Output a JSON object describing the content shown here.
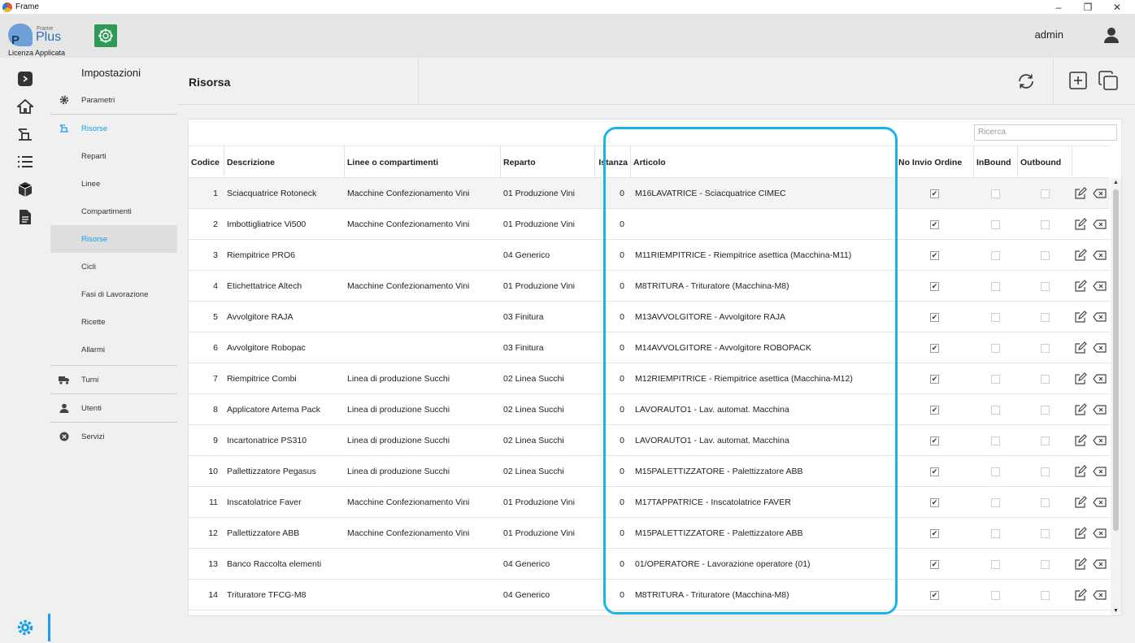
{
  "window": {
    "title": "Frame",
    "minimize": "–",
    "restore": "❐",
    "close": "✕"
  },
  "header": {
    "logo_letter": "P",
    "logo_frame": "Frame",
    "logo_plus": "Plus",
    "license": "Licenza Applicata",
    "user": "admin"
  },
  "settings": {
    "title": "Impostazioni",
    "items": [
      {
        "label": "Parametri",
        "icon": "gear-icon"
      },
      {
        "label": "Risorse",
        "icon": "resource-icon"
      },
      {
        "label": "Reparti"
      },
      {
        "label": "Linee"
      },
      {
        "label": "Compartimenti"
      },
      {
        "label": "Risorse"
      },
      {
        "label": "Cicli"
      },
      {
        "label": "Fasi di Lavorazione"
      },
      {
        "label": "Ricette"
      },
      {
        "label": "Allarmi"
      },
      {
        "label": "Turni",
        "icon": "truck-icon"
      },
      {
        "label": "Utenti",
        "icon": "user-icon"
      },
      {
        "label": "Servizi",
        "icon": "services-icon"
      }
    ]
  },
  "main": {
    "title": "Risorsa",
    "search_placeholder": "Ricerca"
  },
  "table": {
    "columns": [
      "Codice",
      "Descrizione",
      "Linee o compartimenti",
      "Reparto",
      "Istanza",
      "Articolo",
      "No Invio Ordine",
      "InBound",
      "Outbound"
    ],
    "rows": [
      {
        "codice": "1",
        "descrizione": "Sciacquatrice Rotoneck",
        "linee": "Macchine Confezionamento Vini",
        "reparto": "01 Produzione Vini",
        "istanza": "0",
        "articolo": "M16LAVATRICE - Sciacquatrice CIMEC",
        "no_invio": true,
        "inbound": false,
        "outbound": false
      },
      {
        "codice": "2",
        "descrizione": "Imbottigliatrice Vi500",
        "linee": "Macchine Confezionamento Vini",
        "reparto": "01 Produzione Vini",
        "istanza": "0",
        "articolo": "",
        "no_invio": true,
        "inbound": false,
        "outbound": false
      },
      {
        "codice": "3",
        "descrizione": "Riempitrice PRO6",
        "linee": "",
        "reparto": "04 Generico",
        "istanza": "0",
        "articolo": "M11RIEMPITRICE - Riempitrice asettica (Macchina-M11)",
        "no_invio": true,
        "inbound": false,
        "outbound": false
      },
      {
        "codice": "4",
        "descrizione": "Etichettatrice Altech",
        "linee": "Macchine Confezionamento Vini",
        "reparto": "01 Produzione Vini",
        "istanza": "0",
        "articolo": "M8TRITURA - Trituratore (Macchina-M8)",
        "no_invio": true,
        "inbound": false,
        "outbound": false
      },
      {
        "codice": "5",
        "descrizione": "Avvolgitore RAJA",
        "linee": "",
        "reparto": "03 Finitura",
        "istanza": "0",
        "articolo": "M13AVVOLGITORE - Avvolgitore RAJA",
        "no_invio": true,
        "inbound": false,
        "outbound": false
      },
      {
        "codice": "6",
        "descrizione": "Avvolgitore Robopac",
        "linee": "",
        "reparto": "03 Finitura",
        "istanza": "0",
        "articolo": "M14AVVOLGITORE - Avvolgitore ROBOPACK",
        "no_invio": true,
        "inbound": false,
        "outbound": false
      },
      {
        "codice": "7",
        "descrizione": "Riempitrice Combi",
        "linee": "Linea di produzione Succhi",
        "reparto": "02 Linea Succhi",
        "istanza": "0",
        "articolo": "M12RIEMPITRICE - Riempitrice asettica (Macchina-M12)",
        "no_invio": true,
        "inbound": false,
        "outbound": false
      },
      {
        "codice": "8",
        "descrizione": "Applicatore Artema Pack",
        "linee": "Linea di produzione Succhi",
        "reparto": "02 Linea Succhi",
        "istanza": "0",
        "articolo": "LAVORAUTO1 - Lav. automat. Macchina",
        "no_invio": true,
        "inbound": false,
        "outbound": false
      },
      {
        "codice": "9",
        "descrizione": "Incartonatrice PS310",
        "linee": "Linea di produzione Succhi",
        "reparto": "02 Linea Succhi",
        "istanza": "0",
        "articolo": "LAVORAUTO1 - Lav. automat. Macchina",
        "no_invio": true,
        "inbound": false,
        "outbound": false
      },
      {
        "codice": "10",
        "descrizione": "Pallettizzatore Pegasus",
        "linee": "Linea di produzione Succhi",
        "reparto": "02 Linea Succhi",
        "istanza": "0",
        "articolo": "M15PALETTIZZATORE - Palettizzatore ABB",
        "no_invio": true,
        "inbound": false,
        "outbound": false
      },
      {
        "codice": "11",
        "descrizione": "Inscatolatrice Faver",
        "linee": "Macchine Confezionamento Vini",
        "reparto": "01 Produzione Vini",
        "istanza": "0",
        "articolo": "M17TAPPATRICE - Inscatolatrice FAVER",
        "no_invio": true,
        "inbound": false,
        "outbound": false
      },
      {
        "codice": "12",
        "descrizione": "Pallettizzatore ABB",
        "linee": "Macchine Confezionamento Vini",
        "reparto": "01 Produzione Vini",
        "istanza": "0",
        "articolo": "M15PALETTIZZATORE - Palettizzatore ABB",
        "no_invio": true,
        "inbound": false,
        "outbound": false
      },
      {
        "codice": "13",
        "descrizione": "Banco Raccolta elementi",
        "linee": "",
        "reparto": "04 Generico",
        "istanza": "0",
        "articolo": "01/OPERATORE - Lavorazione operatore (01)",
        "no_invio": true,
        "inbound": false,
        "outbound": false
      },
      {
        "codice": "14",
        "descrizione": "Trituratore TFCG-M8",
        "linee": "",
        "reparto": "04 Generico",
        "istanza": "0",
        "articolo": "M8TRITURA - Trituratore (Macchina-M8)",
        "no_invio": true,
        "inbound": false,
        "outbound": false
      }
    ]
  },
  "colors": {
    "accent": "#1aa0e6",
    "highlight": "#1ab4ea",
    "brand_green": "#2f9a56"
  }
}
